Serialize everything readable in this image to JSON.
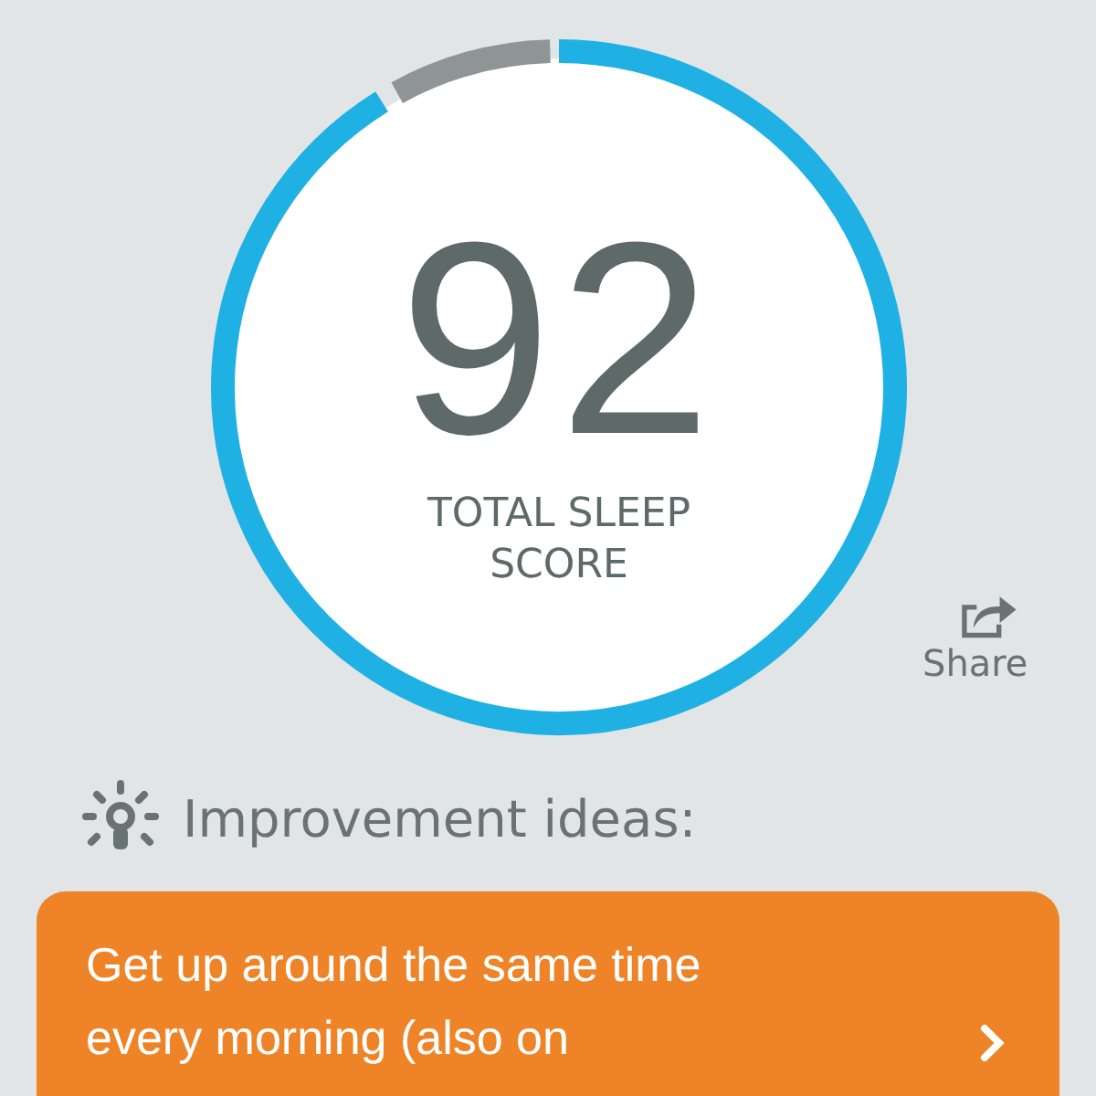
{
  "score": {
    "value": "92",
    "label_lines": [
      "TOTAL SLEEP",
      "SCORE"
    ]
  },
  "share": {
    "label": "Share"
  },
  "improvement": {
    "heading": "Improvement ideas:",
    "cards": [
      {
        "lines": [
          "Get up around the same time",
          "every morning (also on"
        ]
      }
    ]
  }
}
